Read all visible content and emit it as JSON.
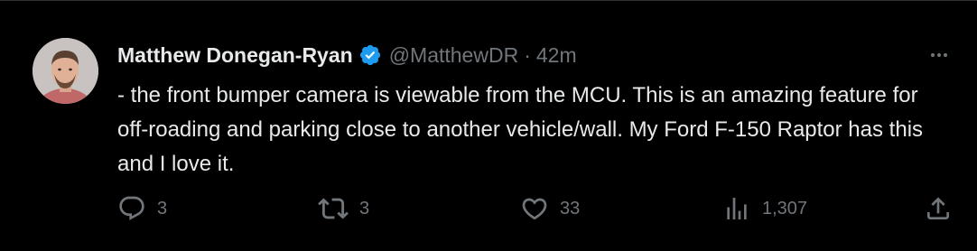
{
  "tweet": {
    "author_name": "Matthew Donegan-Ryan",
    "handle": "@MatthewDR",
    "separator": "·",
    "time": "42m",
    "text": "- the front bumper camera is viewable from the MCU. This is an amazing feature for off-roading and parking close to another vehicle/wall. My Ford F-150 Raptor has this and I love it.",
    "verified": true
  },
  "actions": {
    "reply_count": "3",
    "retweet_count": "3",
    "like_count": "33",
    "views_count": "1,307"
  },
  "icons": {
    "avatar": "avatar",
    "verified": "verified-badge-icon",
    "more": "more-icon",
    "reply": "reply-icon",
    "retweet": "retweet-icon",
    "like": "heart-icon",
    "views": "views-icon",
    "share": "share-icon"
  },
  "colors": {
    "background": "#000000",
    "text": "#e7e9ea",
    "muted": "#71767b",
    "verified": "#1d9bf0"
  }
}
